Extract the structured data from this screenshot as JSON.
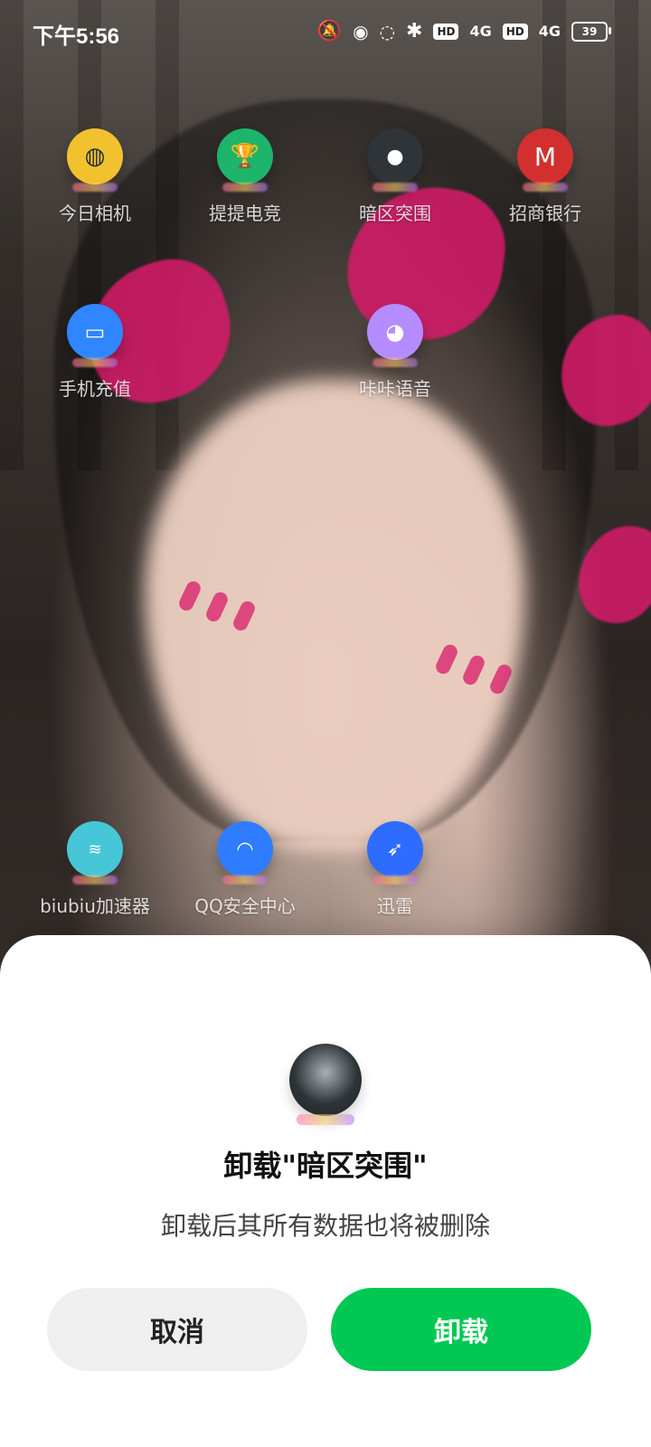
{
  "status_bar": {
    "time": "下午5:56",
    "icons": [
      "bell-off-icon",
      "android-icon",
      "cat-icon",
      "bluetooth-icon",
      "hd-icon",
      "signal-4g-icon",
      "hd-icon",
      "signal-4g-icon",
      "battery-icon"
    ],
    "hd_label": "HD",
    "network_label": "4G",
    "battery_level": "39"
  },
  "home": {
    "row1": [
      {
        "label": "今日相机",
        "icon": "camera-app-icon",
        "color": "#f2c12e"
      },
      {
        "label": "提提电竞",
        "icon": "trophy-icon",
        "color": "#1db46b"
      },
      {
        "label": "暗区突围",
        "icon": "game-icon",
        "color": "#2e3437"
      },
      {
        "label": "招商银行",
        "icon": "bank-icon",
        "color": "#d32f2f"
      }
    ],
    "row2": [
      {
        "label": "手机充值",
        "icon": "phone-icon",
        "color": "#2f86ff"
      },
      {
        "label": "咔咔语音",
        "icon": "bunny-icon",
        "color": "#b58cff"
      }
    ],
    "row3": [
      {
        "label": "biubiu加速器",
        "icon": "accelerator-icon",
        "color": "#46c6d7"
      },
      {
        "label": "QQ安全中心",
        "icon": "qq-icon",
        "color": "#2f7cff"
      },
      {
        "label": "迅雷",
        "icon": "bird-icon",
        "color": "#2e6bff"
      }
    ]
  },
  "dialog": {
    "title": "卸载\"暗区突围\"",
    "message": "卸载后其所有数据也将被删除",
    "cancel_label": "取消",
    "confirm_label": "卸载",
    "confirm_color": "#00c853",
    "cancel_color": "#efefef"
  }
}
